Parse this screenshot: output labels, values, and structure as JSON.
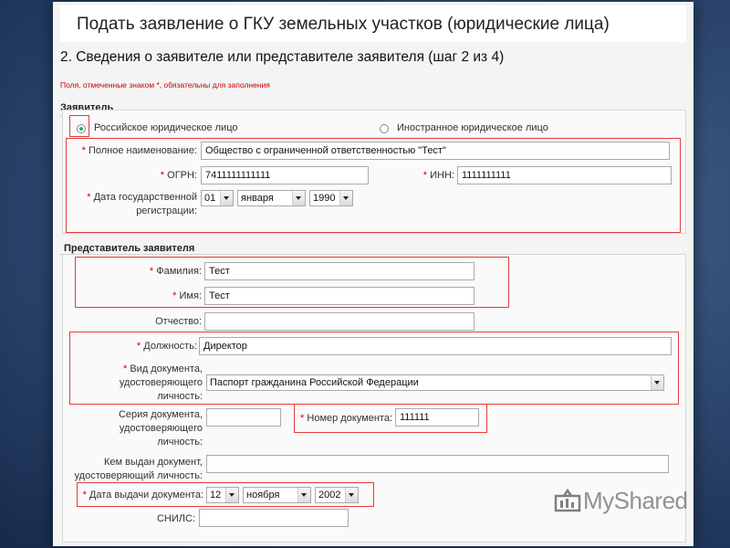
{
  "page": {
    "title": "Подать заявление о ГКУ земельных участков (юридические лица)",
    "step_title": "2. Сведения о заявителе или представителе заявителя (шаг 2 из 4)",
    "required_note": "Поля, отмеченные знаком *, обязательны для заполнения"
  },
  "applicant": {
    "section_title": "Заявитель",
    "type_options": [
      "Российское юридическое лицо",
      "Иностранное юридическое лицо"
    ],
    "selected_type": "Российское юридическое лицо",
    "full_name": {
      "label": "Полное наименование:",
      "value": "Общество с ограниченной ответственностью \"Тест\""
    },
    "ogrn": {
      "label": "ОГРН:",
      "value": "7411111111111"
    },
    "inn": {
      "label": "ИНН:",
      "value": "1111111111"
    },
    "reg_date": {
      "label_line1": "Дата государственной",
      "label_line2": "регистрации:",
      "day": "01",
      "month": "января",
      "year": "1990"
    }
  },
  "representative": {
    "section_title": "Представитель заявителя",
    "surname": {
      "label": "Фамилия:",
      "value": "Тест"
    },
    "name": {
      "label": "Имя:",
      "value": "Тест"
    },
    "patronymic": {
      "label": "Отчество:",
      "value": ""
    },
    "position": {
      "label": "Должность:",
      "value": "Директор"
    },
    "doc_type": {
      "label_line1": "Вид документа,",
      "label_line2": "удостоверяющего",
      "label_line3": "личность:",
      "value": "Паспорт гражданина Российской Федерации"
    },
    "doc_series": {
      "label_line1": "Серия документа,",
      "label_line2": "удостоверяющего",
      "label_line3": "личность:",
      "value": ""
    },
    "doc_number": {
      "label": "Номер документа:",
      "value": "111111"
    },
    "issued_by": {
      "label_line1": "Кем выдан документ,",
      "label_line2": "удостоверяющий личность:",
      "value": ""
    },
    "issue_date": {
      "label": "Дата выдачи документа:",
      "day": "12",
      "month": "ноября",
      "year": "2002"
    },
    "snils": {
      "label": "СНИЛС:",
      "value": ""
    }
  },
  "watermark": {
    "text": "MyShared"
  },
  "colors": {
    "highlight": "#e23c3c",
    "required": "#cc0000",
    "background": "#2f4a73"
  }
}
